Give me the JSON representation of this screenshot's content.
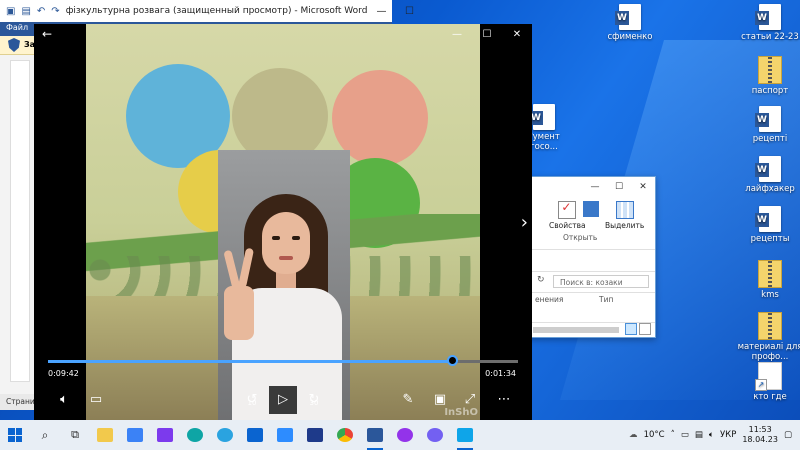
{
  "word": {
    "title": "фізкультурна розвага (защищенный просмотр) - Microsoft Word",
    "file_tab": "Файл",
    "protected_banner": "За",
    "status": "Страниц"
  },
  "desktop_icons": [
    {
      "label": "сфименко",
      "type": "doc"
    },
    {
      "label": "статьи 22-23",
      "type": "doc"
    },
    {
      "label": "паспорт",
      "type": "zip"
    },
    {
      "label": "рецепті",
      "type": "doc"
    },
    {
      "label": "лайфхакер",
      "type": "doc"
    },
    {
      "label": "рецепты",
      "type": "doc"
    },
    {
      "label": "kms",
      "type": "zip"
    },
    {
      "label": "материалі для профо...",
      "type": "zip"
    },
    {
      "label": "кто где",
      "type": "shortcut"
    },
    {
      "label": "ґумент",
      "type": "doc"
    },
    {
      "label": "госо...",
      "type": "doc"
    }
  ],
  "explorer": {
    "properties_label": "Свойства",
    "select_label": "Выделить",
    "group_label": "Открыть",
    "search_placeholder": "Поиск в: козаки",
    "col_name": "енения",
    "col_type": "Тип"
  },
  "player": {
    "current_time": "0:09:42",
    "remaining_time": "0:01:34",
    "progress_fraction": 0.86,
    "skip_back": "10",
    "skip_forward": "30",
    "watermark": "InShO"
  },
  "taskbar": {
    "weather": "10°C",
    "language": "УКР",
    "time": "11:53",
    "date": "18.04.23"
  }
}
